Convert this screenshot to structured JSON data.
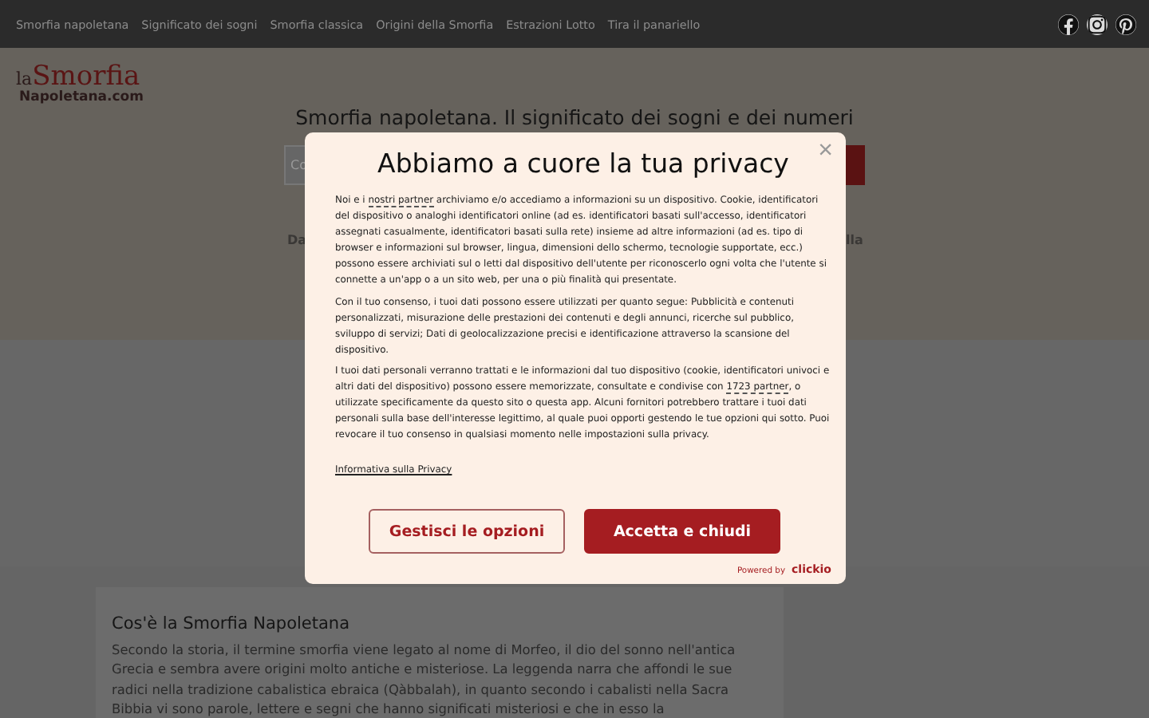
{
  "nav": {
    "items": [
      "Smorfia napoletana",
      "Significato dei sogni",
      "Smorfia classica",
      "Origini della Smorfia",
      "Estrazioni Lotto",
      "Tira il panariello"
    ],
    "social": [
      {
        "kind": "facebook"
      },
      {
        "kind": "instagram"
      },
      {
        "kind": "pinterest"
      }
    ]
  },
  "logo": {
    "prefix": "la",
    "name": "Smorfia",
    "domain": "Napoletana.com"
  },
  "hero": {
    "heading": "Smorfia napoletana. Il significato dei sogni e dei numeri",
    "search_value": "Co",
    "left_fragment": "Da",
    "right_fragment": "lla"
  },
  "article": {
    "title": "Cos'è la Smorfia Napoletana",
    "text": "Secondo la storia, il termine smorfia viene legato al nome di Morfeo, il dio del sonno nell'antica Grecia e sembra avere origini molto antiche e misteriose. La leggenda narra che affondi le sue radici nella tradizione cabalistica ebraica (Qàbbalah), in quanto secondo i cabalisti nella Sacra Bibbia vi sono parole, lettere e segni che hanno significati misteriosi e che in esso la"
  },
  "consent": {
    "title": "Abbiamo a cuore la tua privacy",
    "close": "×",
    "paragraphs": [
      [
        {
          "text": "Noi e i "
        },
        {
          "text": "nostri partner",
          "link": true
        },
        {
          "text": " archiviamo e/o accediamo a informazioni su un dispositivo. Cookie, identificatori del dispositivo o analoghi identificatori online (ad es. identificatori basati sull'accesso, identificatori assegnati casualmente, identificatori basati sulla rete) insieme ad altre informazioni (ad es. tipo di browser e informazioni sul browser, lingua, dimensioni dello schermo, tecnologie supportate, ecc.) possono essere archiviati sul o letti dal dispositivo dell'utente per riconoscerlo ogni volta che l'utente si connette a un'app o a un sito web, per una o più finalità qui presentate."
        }
      ],
      [
        {
          "text": "Con il tuo consenso, i tuoi dati possono essere utilizzati per quanto segue: Pubblicità e contenuti personalizzati, misurazione delle prestazioni dei contenuti e degli annunci, ricerche sul pubblico, sviluppo di servizi; Dati di geolocalizzazione precisi e identificazione attraverso la scansione del dispositivo."
        }
      ],
      [
        {
          "text": "I tuoi dati personali verranno trattati e le informazioni dal tuo dispositivo (cookie, identificatori univoci e altri dati del dispositivo) possono essere memorizzate, consultate e condivise con "
        },
        {
          "text": "1723 partner",
          "link": true
        },
        {
          "text": ", o utilizzate specificamente da questo sito o questa app. Alcuni fornitori potrebbero trattare i tuoi dati personali sulla base dell'interesse legittimo, al quale puoi opporti gestendo le tue opzioni qui sotto. Puoi revocare il tuo consenso in qualsiasi momento nelle impostazioni sulla privacy."
        }
      ]
    ],
    "privacy_link": "Informativa sulla Privacy",
    "buttons": [
      {
        "label": "Gestisci le opzioni",
        "kind": "secondary"
      },
      {
        "label": "Accetta e chiudi",
        "kind": "primary"
      }
    ],
    "powered_by": "Powered by",
    "brand": "clickio"
  }
}
